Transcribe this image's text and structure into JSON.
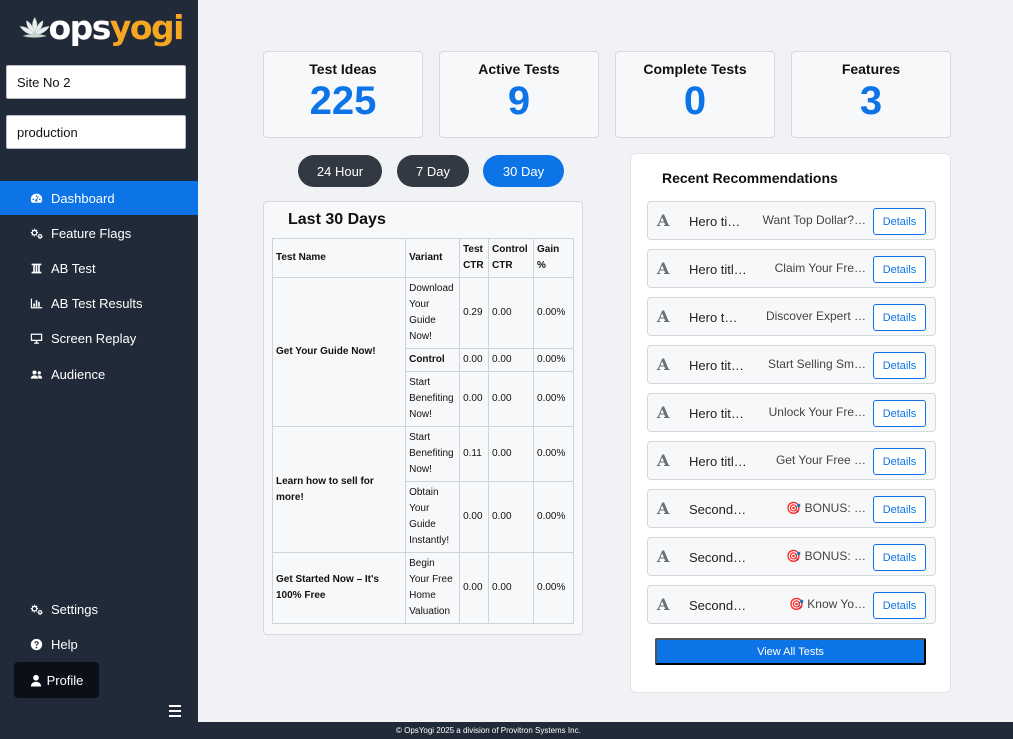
{
  "brand": {
    "ops": "ops",
    "yogi": "yogi",
    "accent_color": "#f5a623"
  },
  "sidebar": {
    "site_input": "Site No 2",
    "env_input": "production",
    "items": [
      {
        "label": "Dashboard",
        "icon": "gauge-icon"
      },
      {
        "label": "Feature Flags",
        "icon": "gears-icon"
      },
      {
        "label": "AB Test",
        "icon": "ab-icon"
      },
      {
        "label": "AB Test Results",
        "icon": "bar-chart-icon"
      },
      {
        "label": "Screen Replay",
        "icon": "monitor-icon"
      },
      {
        "label": "Audience",
        "icon": "users-icon"
      }
    ],
    "bottom_items": [
      {
        "label": "Settings",
        "icon": "gears-icon"
      },
      {
        "label": "Help",
        "icon": "question-icon"
      }
    ],
    "profile_label": "Profile"
  },
  "stats": [
    {
      "label": "Test Ideas",
      "value": "225"
    },
    {
      "label": "Active Tests",
      "value": "9"
    },
    {
      "label": "Complete Tests",
      "value": "0"
    },
    {
      "label": "Features",
      "value": "3"
    }
  ],
  "periods": [
    "24 Hour",
    "7 Day",
    "30 Day"
  ],
  "active_period": "30 Day",
  "last_days": {
    "title": "Last 30 Days",
    "headers": {
      "name": "Test Name",
      "variant": "Variant",
      "test_ctr": "Test CTR",
      "control_ctr": "Control CTR",
      "gain": "Gain %"
    },
    "tests": [
      {
        "name": "Get Your Guide Now!",
        "rows": [
          {
            "variant": "Download Your Guide Now!",
            "test_ctr": "0.29",
            "control_ctr": "0.00",
            "gain": "0.00%"
          },
          {
            "variant": "Control",
            "test_ctr": "0.00",
            "control_ctr": "0.00",
            "gain": "0.00%"
          },
          {
            "variant": "Start Benefiting Now!",
            "test_ctr": "0.00",
            "control_ctr": "0.00",
            "gain": "0.00%"
          }
        ]
      },
      {
        "name": "Learn how to sell for more!",
        "rows": [
          {
            "variant": "Start Benefiting Now!",
            "test_ctr": "0.11",
            "control_ctr": "0.00",
            "gain": "0.00%"
          },
          {
            "variant": "Obtain Your Guide Instantly!",
            "test_ctr": "0.00",
            "control_ctr": "0.00",
            "gain": "0.00%"
          }
        ]
      },
      {
        "name": "Get Started Now – It's 100% Free",
        "rows": [
          {
            "variant": "Begin Your Free Home Valuation",
            "test_ctr": "0.00",
            "control_ctr": "0.00",
            "gain": "0.00%"
          }
        ]
      }
    ]
  },
  "recommendations": {
    "title": "Recent Recommendations",
    "details_label": "Details",
    "items": [
      {
        "type": "Hero ti…",
        "text": "Want Top Dollar?…"
      },
      {
        "type": "Hero titl…",
        "text": "Claim Your Fre…"
      },
      {
        "type": "Hero t…",
        "text": "Discover Expert …"
      },
      {
        "type": "Hero tit…",
        "text": "Start Selling Sm…"
      },
      {
        "type": "Hero tit…",
        "text": "Unlock Your Fre…"
      },
      {
        "type": "Hero title…",
        "text": "Get Your Free …"
      },
      {
        "type": "Secondar…",
        "text": "🎯 BONUS: …"
      },
      {
        "type": "Secondar…",
        "text": "🎯 BONUS: …"
      },
      {
        "type": "Secondary…",
        "text": "🎯 Know Yo…"
      }
    ],
    "view_all_label": "View All Tests"
  },
  "footer": {
    "text": "© OpsYogi 2025 a division of Provitron Systems Inc."
  }
}
